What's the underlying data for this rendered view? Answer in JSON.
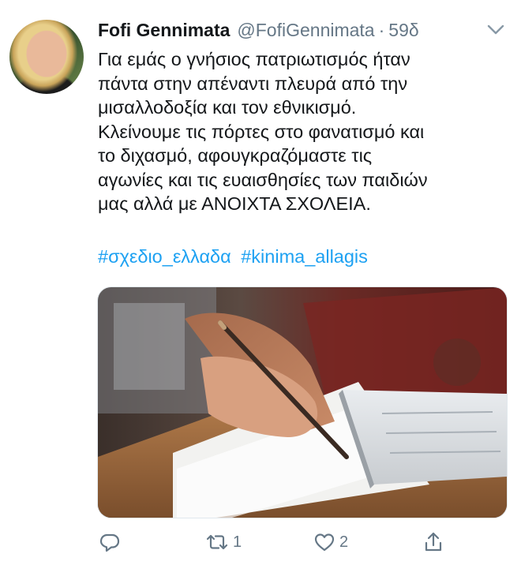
{
  "tweet": {
    "author_name": "Fofi Gennimata",
    "handle": "@FofiGennimata",
    "separator": "·",
    "time": "59δ",
    "text_lines": [
      "Για εμάς ο γνήσιος πατριωτισμός ήταν",
      "πάντα στην απέναντι πλευρά από την",
      "μισαλλοδοξία και τον εθνικισμό.",
      "Κλείνουμε τις πόρτες στο φανατισμό και",
      "το διχασμό, αφουγκραζόμαστε τις",
      "αγωνίες και τις ευαισθησίες των παιδιών",
      "μας αλλά με ΑΝΟΙΧΤΑ ΣΧΟΛΕΙΑ."
    ],
    "hashtags": [
      "#σχεδιο_ελλαδα",
      "#kinima_allagis"
    ]
  },
  "actions": {
    "reply_count": "",
    "retweet_count": "1",
    "like_count": "2"
  },
  "icons": {
    "avatar": "profile-photo",
    "chevron": "chevron-down-icon",
    "reply": "reply-icon",
    "retweet": "retweet-icon",
    "like": "heart-icon",
    "share": "share-icon"
  },
  "colors": {
    "text": "#14171a",
    "muted": "#657786",
    "link": "#1da1f2"
  }
}
